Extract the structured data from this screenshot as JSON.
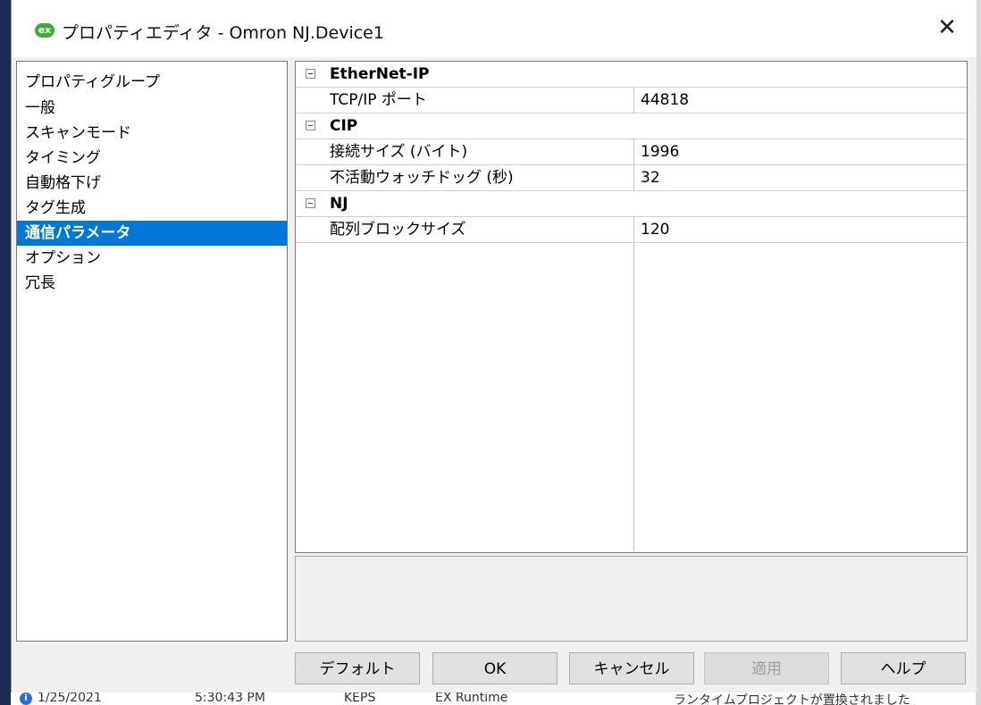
{
  "window": {
    "icon": "ex-app-icon",
    "icon_text": "ex",
    "title": "プロパティエディタ - Omron NJ.Device1",
    "close_glyph": "✕"
  },
  "property_groups": {
    "header": "プロパティグループ",
    "items": [
      {
        "label": "一般"
      },
      {
        "label": "スキャンモード"
      },
      {
        "label": "タイミング"
      },
      {
        "label": "自動格下げ"
      },
      {
        "label": "タグ生成"
      },
      {
        "label": "通信パラメータ",
        "selected": true
      },
      {
        "label": "オプション"
      },
      {
        "label": "冗長"
      }
    ]
  },
  "property_grid": {
    "categories": [
      {
        "name": "EtherNet-IP",
        "properties": [
          {
            "name": "TCP/IP ポート",
            "value": "44818"
          }
        ]
      },
      {
        "name": "CIP",
        "properties": [
          {
            "name": "接続サイズ (バイト)",
            "value": "1996"
          },
          {
            "name": "不活動ウォッチドッグ (秒)",
            "value": "32"
          }
        ]
      },
      {
        "name": "NJ",
        "properties": [
          {
            "name": "配列ブロックサイズ",
            "value": "120"
          }
        ]
      }
    ]
  },
  "buttons": {
    "default": "デフォルト",
    "ok": "OK",
    "cancel": "キャンセル",
    "apply": "適用",
    "help": "ヘルプ"
  },
  "statusbar": {
    "icon": "info-icon",
    "icon_text": "i",
    "date": "1/25/2021",
    "time": "5:30:43 PM",
    "user": "KEPS",
    "source": "EX Runtime",
    "message": "ランタイムプロジェクトが置換されました"
  },
  "colors": {
    "selection": "#0078d7",
    "app_icon": "#3cae3c",
    "left_strip": "#1b2a4e"
  }
}
